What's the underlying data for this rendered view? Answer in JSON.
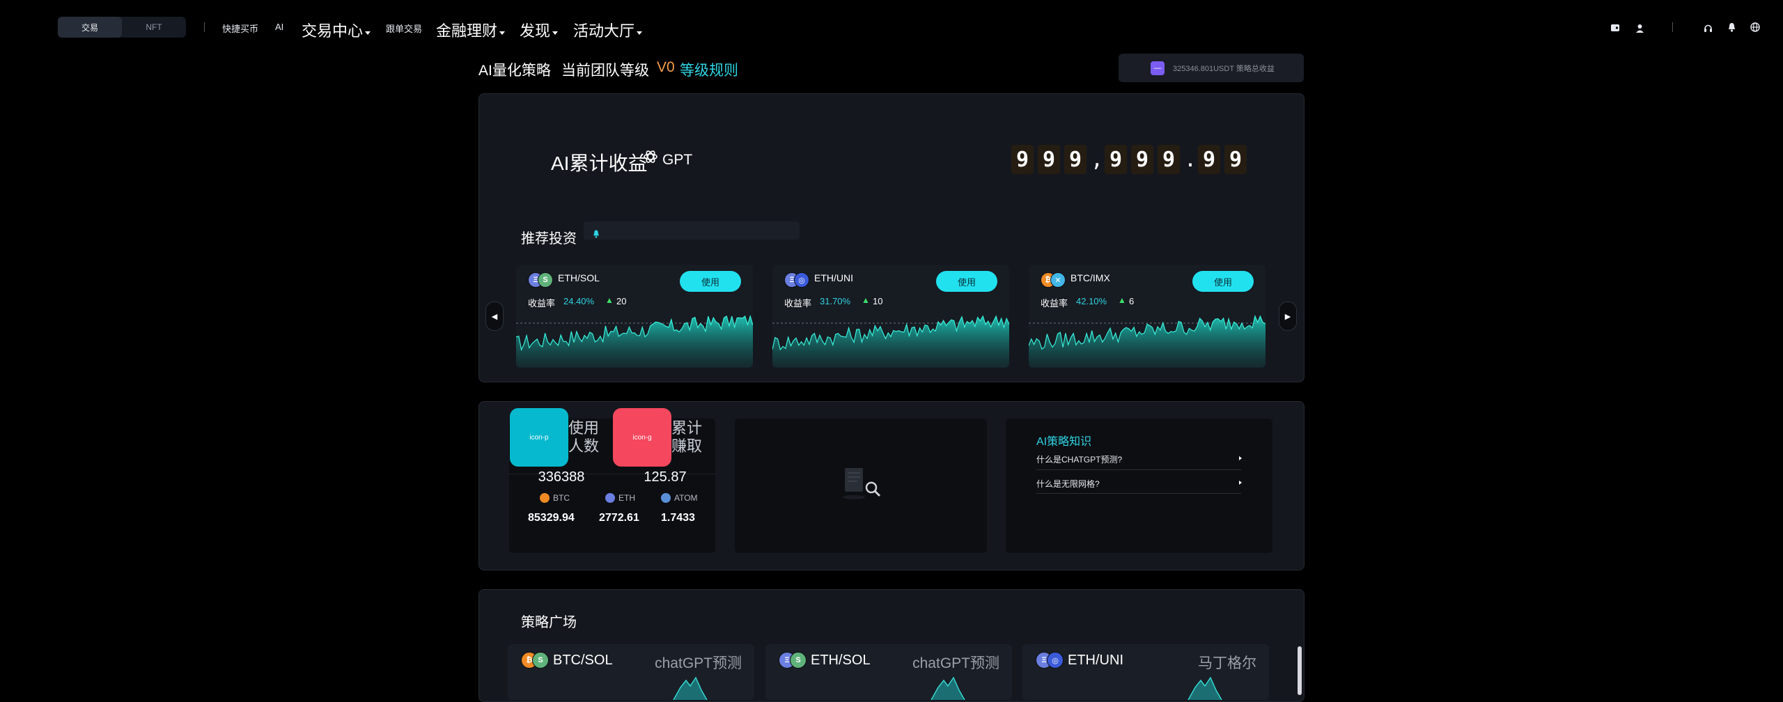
{
  "header": {
    "seg": [
      "交易",
      "NFT"
    ],
    "nav_small": [
      "快捷买币",
      "AI"
    ],
    "nav_large": [
      "交易中心",
      "跟单交易",
      "金融理财",
      "发现",
      "活动大厅"
    ]
  },
  "title_row": {
    "strategy": "AI量化策略",
    "team_label": "当前团队等级",
    "level": "V0",
    "rules": "等级规则",
    "earnings_badge": "325346.801USDT 策略总收益"
  },
  "hero": {
    "label": "AI累计收益",
    "gpt": "GPT",
    "digits": [
      "9",
      "9",
      "9",
      ",",
      "9",
      "9",
      "9",
      ".",
      "9",
      "9"
    ]
  },
  "recommend": {
    "title": "推荐投资",
    "use_label": "使用",
    "rate_label": "收益率",
    "cards": [
      {
        "pair": "ETH/SOL",
        "rate": "24.40%",
        "count": "20",
        "coin1": "#6b7fe0",
        "coin2": "#5fb27a",
        "g1": "Ξ",
        "g2": "S"
      },
      {
        "pair": "ETH/UNI",
        "rate": "31.70%",
        "count": "10",
        "coin1": "#6b7fe0",
        "coin2": "#3b5bdb",
        "g1": "Ξ",
        "g2": "◎"
      },
      {
        "pair": "BTC/IMX",
        "rate": "42.10%",
        "count": "6",
        "coin1": "#f08a24",
        "coin2": "#43b6e8",
        "g1": "₿",
        "g2": "✕"
      }
    ]
  },
  "stats": {
    "icon_p": "icon-p",
    "icon_g": "icon-g",
    "users_label": [
      "使用",
      "人数"
    ],
    "users_value": "336388",
    "earn_label": [
      "累计",
      "赚取"
    ],
    "earn_value": "125.87",
    "coins": [
      {
        "name": "BTC",
        "value": "85329.94",
        "color": "#f08a24"
      },
      {
        "name": "ETH",
        "value": "2772.61",
        "color": "#6b7fe0"
      },
      {
        "name": "ATOM",
        "value": "1.7433",
        "color": "#5a8fd8"
      }
    ]
  },
  "faq": {
    "title": "AI策略知识",
    "items": [
      "什么是CHATGPT预测?",
      "什么是无限网格?"
    ]
  },
  "plaza": {
    "title": "策略广场",
    "cards": [
      {
        "pair": "BTC/SOL",
        "tag": "chatGPT预测",
        "c1": "#f08a24",
        "c2": "#5fb27a",
        "g1": "₿",
        "g2": "S"
      },
      {
        "pair": "ETH/SOL",
        "tag": "chatGPT预测",
        "c1": "#6b7fe0",
        "c2": "#5fb27a",
        "g1": "Ξ",
        "g2": "S"
      },
      {
        "pair": "ETH/UNI",
        "tag": "马丁格尔",
        "c1": "#6b7fe0",
        "c2": "#3b5bdb",
        "g1": "Ξ",
        "g2": "◎"
      }
    ]
  },
  "colors": {
    "accent": "#22e1ef",
    "orange": "#f59c4a",
    "panel": "#14171e"
  }
}
